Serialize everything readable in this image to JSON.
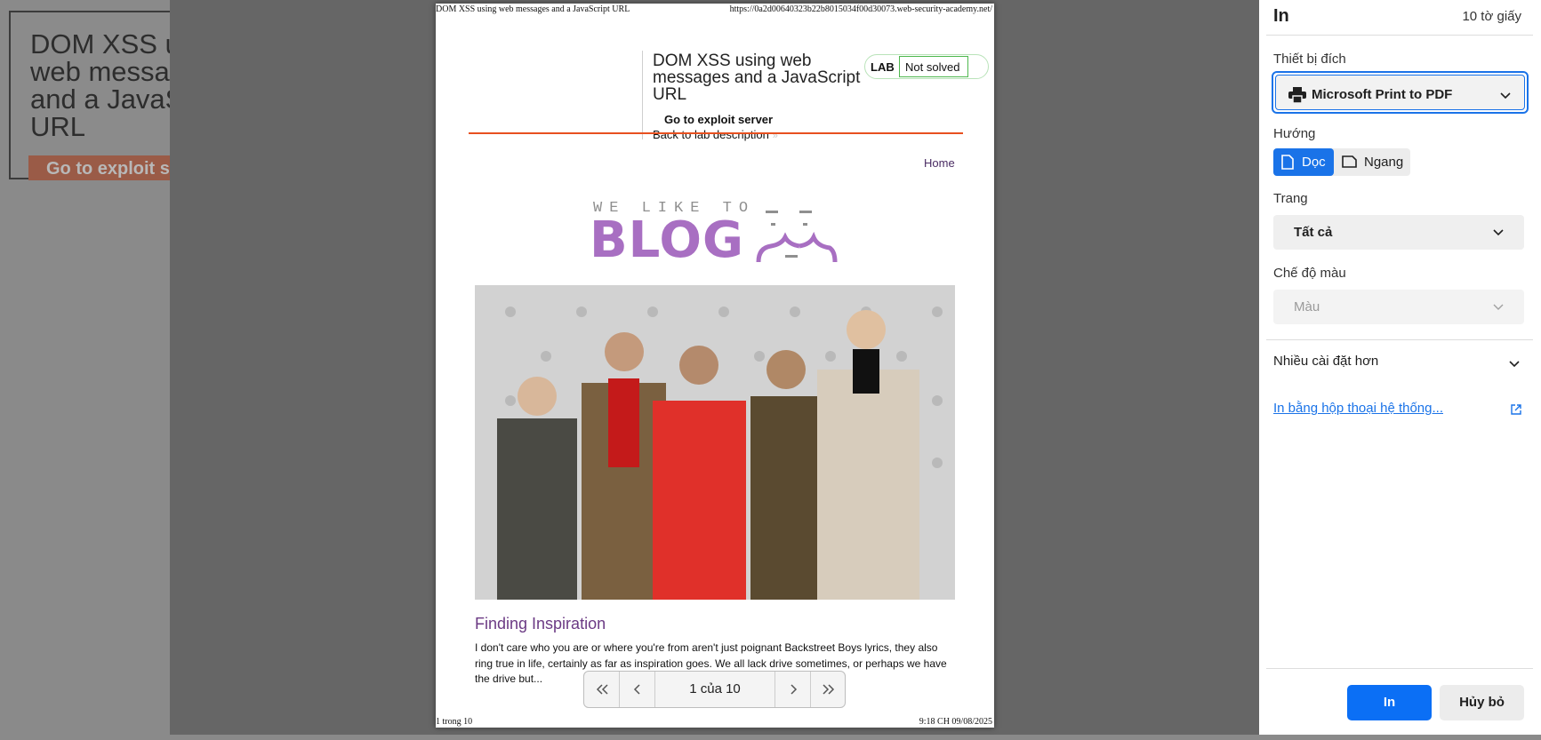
{
  "background_page": {
    "lab_title": "DOM XSS using web messages and a JavaScript URL",
    "exploit_button": "Go to exploit server"
  },
  "preview": {
    "header_left": "DOM XSS using web messages and a JavaScript URL",
    "header_right": "https://0a2d00640323b22b8015034f00d30073.web-security-academy.net/",
    "footer_left": "1 trong 10",
    "footer_right": "9:18 CH 09/08/2025",
    "lab": {
      "title": "DOM XSS using web messages and a JavaScript URL",
      "badge_label": "LAB",
      "status": "Not solved",
      "exploit_link": "Go to exploit server",
      "back_link": "Back to lab description",
      "back_arrow": "»"
    },
    "nav_home": "Home",
    "logo": {
      "tagline": "WE LIKE TO",
      "word": "BLOG"
    },
    "post": {
      "title": "Finding Inspiration",
      "excerpt": "I don't care who you are or where you're from aren't just poignant Backstreet Boys lyrics, they also ring true in life, certainly as far as inspiration goes. We all lack drive sometimes, or perhaps we have the drive but..."
    },
    "page_nav": {
      "first_icon": "double-chevron-left-icon",
      "prev_icon": "chevron-left-icon",
      "indicator": "1 của 10",
      "next_icon": "chevron-right-icon",
      "last_icon": "double-chevron-right-icon"
    }
  },
  "settings": {
    "title": "In",
    "sheet_count": "10 tờ giấy",
    "destination_label": "Thiết bị đích",
    "destination_value": "Microsoft Print to PDF",
    "orientation_label": "Hướng",
    "orientation_portrait": "Dọc",
    "orientation_landscape": "Ngang",
    "orientation_selected": "portrait",
    "pages_label": "Trang",
    "pages_value": "Tất cả",
    "color_label": "Chế độ màu",
    "color_value": "Màu",
    "more_settings": "Nhiều cài đặt hơn",
    "system_dialog": "In bằng hộp thoại hệ thống...",
    "print_button": "In",
    "cancel_button": "Hủy bỏ",
    "accent_color": "#1a73e8"
  }
}
